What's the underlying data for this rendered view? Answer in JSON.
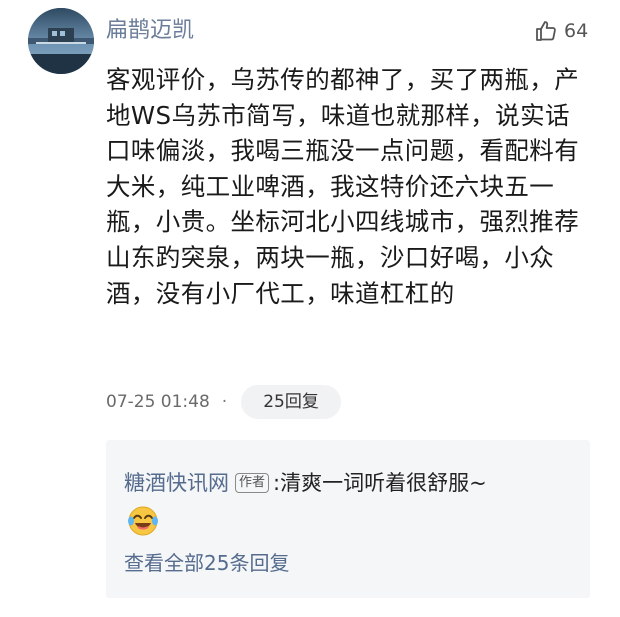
{
  "comment": {
    "username": "扁鹊迈凯",
    "like_count": "64",
    "text": "客观评价，乌苏传的都神了，买了两瓶，产地WS乌苏市简写，味道也就那样，说实话口味偏淡，我喝三瓶没一点问题，看配料有大米，纯工业啤酒，我这特价还六块五一瓶，小贵。坐标河北小四线城市，强烈推荐山东趵突泉，两块一瓶，沙口好喝，小众酒，没有小厂代工，味道杠杠的",
    "timestamp": "07-25 01:48",
    "separator": "·",
    "reply_button_label": "25回复"
  },
  "reply_preview": {
    "author": "糖酒快讯网",
    "author_tag": "作者",
    "colon": ":",
    "text": " 清爽一词听着很舒服~",
    "emoji": "laughing-tears-emoji",
    "view_all_label": "查看全部25条回复"
  },
  "icons": {
    "like": "thumbs-up-icon"
  },
  "colors": {
    "username": "#6b7d99",
    "link": "#556c8e",
    "reply_bg": "#f5f6f8",
    "pill_bg": "#f1f2f4"
  }
}
